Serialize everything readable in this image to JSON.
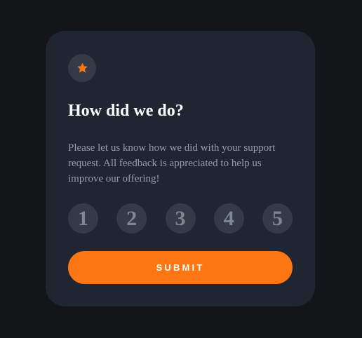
{
  "card": {
    "title": "How did we do?",
    "description": "Please let us know how we did with your support request. All feedback is appreciated to help us improve our offering!",
    "star_icon": "star-icon"
  },
  "ratings": [
    {
      "label": "1"
    },
    {
      "label": "2"
    },
    {
      "label": "3"
    },
    {
      "label": "4"
    },
    {
      "label": "5"
    }
  ],
  "submit_label": "SUBMIT",
  "colors": {
    "page_bg": "#131518",
    "card_bg": "#1f2631",
    "circle_bg": "#343b47",
    "accent": "#fc7614",
    "text_muted": "#959eac",
    "rating_text": "#7c8798"
  }
}
